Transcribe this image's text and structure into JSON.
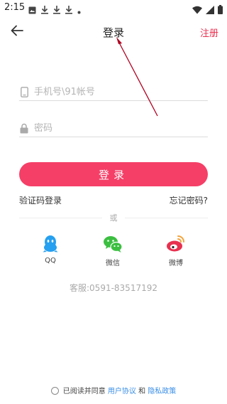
{
  "status_bar": {
    "time": "2:15",
    "icons_left": [
      "image-icon",
      "download-icon",
      "download-icon",
      "download-icon",
      "dot-icon"
    ],
    "icons_right": [
      "wifi-icon",
      "signal-icon",
      "battery-icon"
    ]
  },
  "nav": {
    "title": "登录",
    "register": "注册"
  },
  "form": {
    "phone_placeholder": "手机号\\91帐号",
    "password_placeholder": "密码",
    "login_label": "登录"
  },
  "links": {
    "sms_login": "验证码登录",
    "forgot_password": "忘记密码?"
  },
  "divider_text": "或",
  "social": [
    {
      "label": "QQ",
      "icon": "qq-icon",
      "color": "#26a0f0"
    },
    {
      "label": "微信",
      "icon": "wechat-icon",
      "color": "#3cbf41"
    },
    {
      "label": "微博",
      "icon": "weibo-icon",
      "color": "#e8304f"
    }
  ],
  "service": "客服:0591-83517192",
  "agreement": {
    "prefix": "已阅读并同意",
    "user_agreement": "用户协议",
    "and": "和",
    "privacy_policy": "隐私政策"
  },
  "colors": {
    "accent": "#f53f67",
    "register": "#e8304f",
    "link": "#3a8ee6",
    "annotation_arrow": "#b00020"
  }
}
